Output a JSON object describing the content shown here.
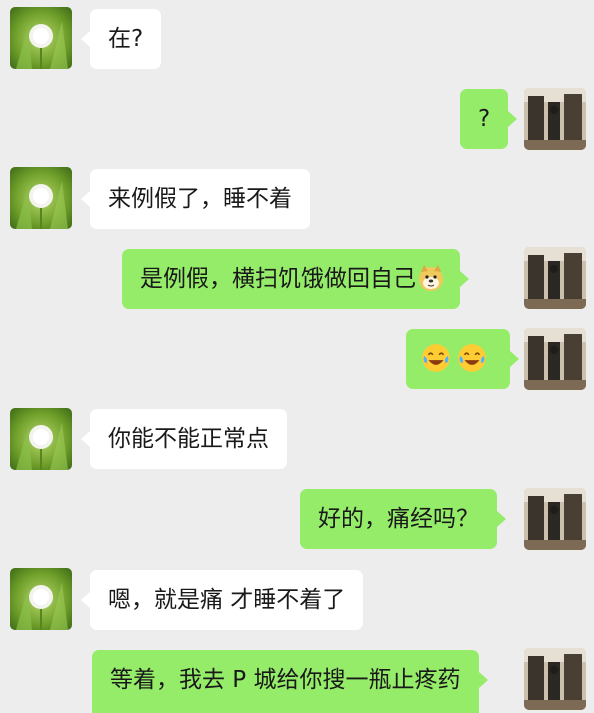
{
  "chat": {
    "messages": [
      {
        "side": "in",
        "text": "在?"
      },
      {
        "side": "out",
        "text": "?"
      },
      {
        "side": "in",
        "text": "来例假了，睡不着"
      },
      {
        "side": "out",
        "text": "是例假，横扫饥饿做回自己",
        "emoji_after": "doge-emoji"
      },
      {
        "side": "out",
        "text": "",
        "emojis": [
          "laugh-cry-emoji",
          "laugh-cry-emoji"
        ]
      },
      {
        "side": "in",
        "text": "你能不能正常点"
      },
      {
        "side": "out",
        "text": "好的，痛经吗？"
      },
      {
        "side": "in",
        "text": "嗯，就是痛 才睡不着了"
      },
      {
        "side": "out",
        "text": "等着，我去 P 城给你搜一瓶止疼药"
      }
    ]
  },
  "colors": {
    "background": "#ededed",
    "incoming_bubble": "#ffffff",
    "outgoing_bubble": "#95ec69",
    "text": "#191919"
  },
  "avatars": {
    "contact": "dandelion-avatar",
    "self": "room-photo-avatar"
  }
}
